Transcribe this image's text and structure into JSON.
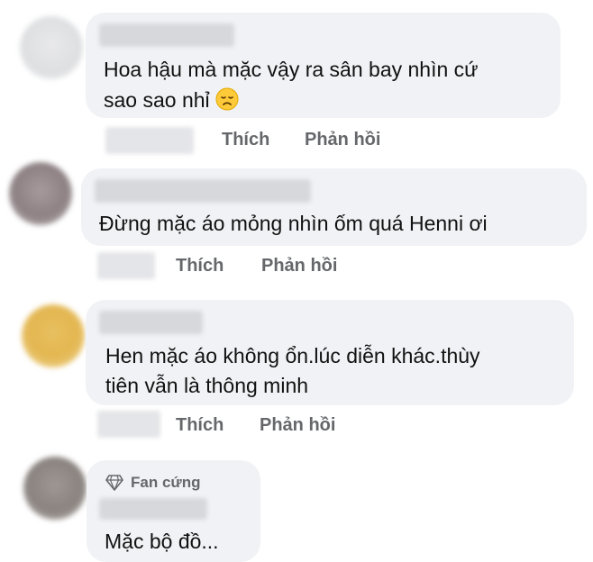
{
  "comments": [
    {
      "line1": "Hoa hậu mà mặc vậy ra sân bay nhìn cứ",
      "line2": "sao sao nhỉ",
      "emoji": "disappointed-face-emoji",
      "like_label": "Thích",
      "reply_label": "Phản hồi"
    },
    {
      "line1": "Đừng mặc áo mỏng nhìn ốm quá Henni ơi",
      "like_label": "Thích",
      "reply_label": "Phản hồi"
    },
    {
      "line1": "Hen mặc áo không ổn.lúc diễn khác.thùy",
      "line2": "tiên vẫn là thông minh",
      "like_label": "Thích",
      "reply_label": "Phản hồi"
    },
    {
      "badge_icon": "diamond-icon",
      "badge_label": "Fan cứng",
      "line1": "Mặc bộ đồ..."
    }
  ],
  "colors": {
    "bubble": "#f0f2f5",
    "action_text": "#65676b",
    "comment_text": "#111111"
  }
}
